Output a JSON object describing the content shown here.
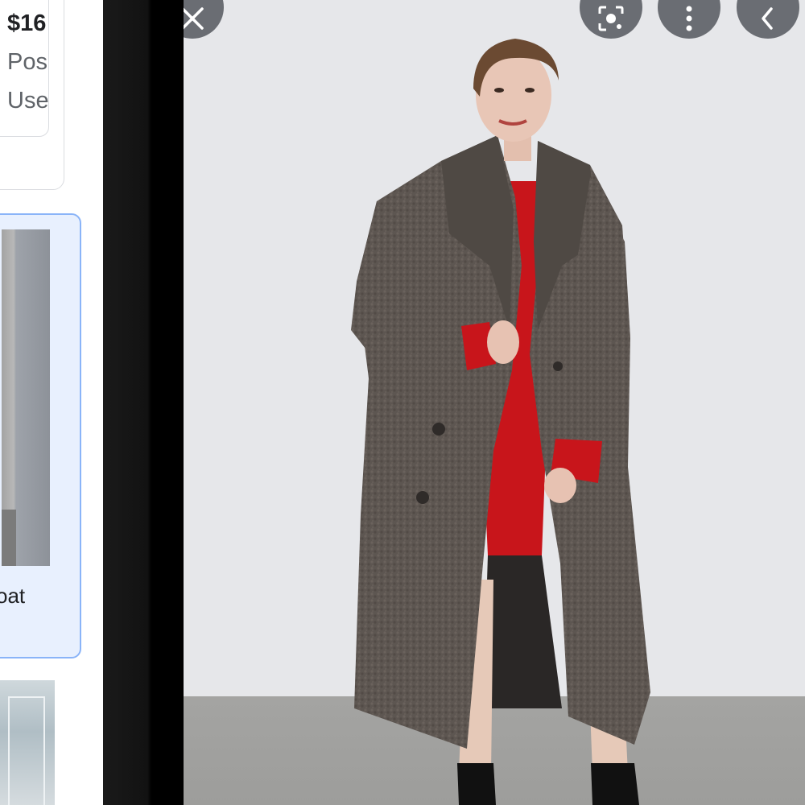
{
  "results": {
    "card1": {
      "price": "$16",
      "line2": "Pos",
      "line3": "Use"
    },
    "card2": {
      "caption": "coat"
    }
  },
  "overlay": {
    "close_icon": "close-icon",
    "lens_icon": "google-lens-icon",
    "more_icon": "more-vert-icon",
    "back_icon": "chevron-left-icon"
  },
  "colors": {
    "accent_border": "#8ab4f8",
    "selected_bg": "#e8f0fe",
    "overlay_button": "#5f6368"
  }
}
